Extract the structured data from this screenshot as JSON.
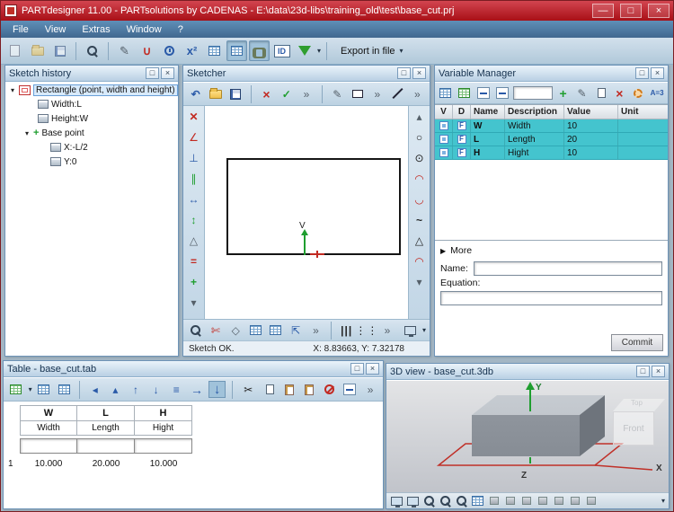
{
  "window": {
    "title": "PARTdesigner 11.00 - PARTsolutions by CADENAS - E:\\data\\23d-libs\\training_old\\test\\base_cut.prj"
  },
  "menubar": {
    "items": [
      "File",
      "View",
      "Extras",
      "Window",
      "?"
    ]
  },
  "toolbar": {
    "id_label": "ID",
    "formula_label": "x²",
    "export_label": "Export in file"
  },
  "sketch_history": {
    "title": "Sketch history",
    "root_label": "Rectangle (point, width and height)",
    "items": [
      "Width:L",
      "Height:W"
    ],
    "base_point_label": "Base point",
    "base_items": [
      "X:-L/2",
      "Y:0"
    ]
  },
  "sketcher": {
    "title": "Sketcher",
    "axis_v_label": "V",
    "status": "Sketch OK.",
    "coords": "X: 8.83663, Y: 7.32178"
  },
  "variable_manager": {
    "title": "Variable Manager",
    "columns": [
      "V",
      "D",
      "Name",
      "Description",
      "Value",
      "Unit"
    ],
    "rows": [
      {
        "flag": "F",
        "name": "W",
        "description": "Width",
        "value": "10"
      },
      {
        "flag": "F",
        "name": "L",
        "description": "Length",
        "value": "20"
      },
      {
        "flag": "F",
        "name": "H",
        "description": "Hight",
        "value": "10"
      }
    ],
    "more_label": "More",
    "name_label": "Name:",
    "equation_label": "Equation:",
    "commit_label": "Commit",
    "rename_icon_label": "A=3"
  },
  "table_panel": {
    "title": "Table - base_cut.tab",
    "columns": [
      {
        "key": "W",
        "label": "Width"
      },
      {
        "key": "L",
        "label": "Length"
      },
      {
        "key": "H",
        "label": "Hight"
      }
    ],
    "row_number": "1",
    "values": [
      "10.000",
      "20.000",
      "10.000"
    ]
  },
  "view3d": {
    "title": "3D view - base_cut.3db",
    "axis_x": "X",
    "axis_y": "Y",
    "axis_z": "Z",
    "cube_front_label": "Front",
    "cube_top_label": "Top"
  },
  "colors": {
    "titlebar": "#a80f16",
    "menubar": "#41688f",
    "row_highlight": "#44c4ce",
    "accent_red": "#c22a22",
    "accent_green": "#1f9e2f"
  }
}
